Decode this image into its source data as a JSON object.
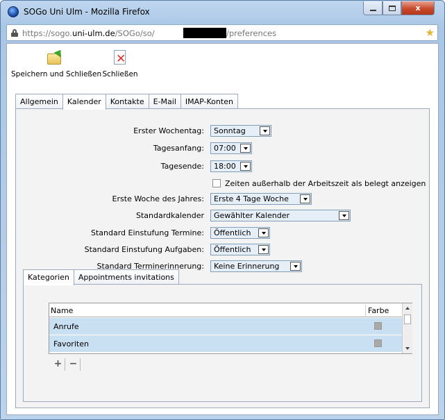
{
  "window": {
    "title": "SOGo Uni Ulm - Mozilla Firefox",
    "controls": {
      "close": "x"
    }
  },
  "url": {
    "prefix": "https://sogo.",
    "host": "uni-ulm.de",
    "path": "/SOGo/so/",
    "suffix": "/preferences"
  },
  "toolbar": {
    "save_label": "Speichern und Schließen",
    "close_label": "Schließen"
  },
  "tabs": [
    "Allgemein",
    "Kalender",
    "Kontakte",
    "E-Mail",
    "IMAP-Konten"
  ],
  "active_tab": "Kalender",
  "calendar": {
    "first_weekday": {
      "label": "Erster Wochentag:",
      "value": "Sonntag"
    },
    "day_start": {
      "label": "Tagesanfang:",
      "value": "07:00"
    },
    "day_end": {
      "label": "Tagesende:",
      "value": "18:00"
    },
    "busy_outside": {
      "label": "Zeiten außerhalb der Arbeitszeit als belegt anzeigen",
      "checked": false
    },
    "first_week": {
      "label": "Erste Woche des Jahres:",
      "value": "Erste 4 Tage Woche"
    },
    "default_calendar": {
      "label": "Standardkalender",
      "value": "Gewählter Kalender"
    },
    "event_class": {
      "label": "Standard Einstufung Termine:",
      "value": "Öffentlich"
    },
    "task_class": {
      "label": "Standard Einstufung Aufgaben:",
      "value": "Öffentlich"
    },
    "reminder": {
      "label": "Standard Terminerinnerung:",
      "value": "Keine Erinnerung"
    }
  },
  "subtabs": [
    "Kategorien",
    "Appointments invitations"
  ],
  "categories": {
    "columns": {
      "name": "Name",
      "color": "Farbe"
    },
    "rows": [
      {
        "name": "Anrufe",
        "color": "#a9a9a9"
      },
      {
        "name": "Favoriten",
        "color": "#a9a9a9"
      }
    ],
    "add": "+",
    "remove": "−"
  },
  "colors": {
    "selected_row": "#c9dff2",
    "select_bg": "#e6eef8"
  }
}
